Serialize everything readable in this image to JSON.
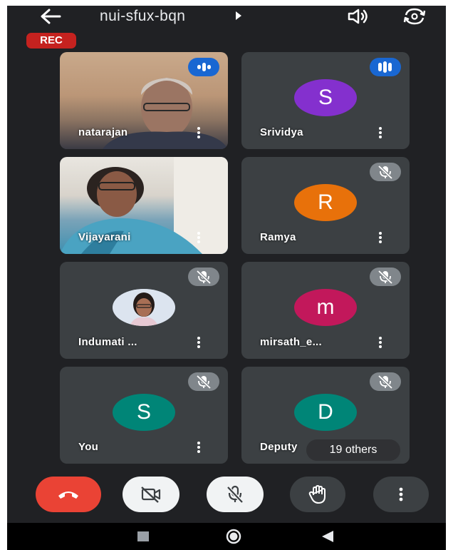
{
  "header": {
    "meeting_code": "nui-sfux-bqn",
    "rec_badge": "REC"
  },
  "participants": [
    {
      "name": "natarajan",
      "status": "speaking",
      "video": true
    },
    {
      "name": "Srividya",
      "initial": "S",
      "avatar_color": "#8430ce",
      "status": "speaking",
      "video": false
    },
    {
      "name": "Vijayarani",
      "status": "unmuted",
      "video": true
    },
    {
      "name": "Ramya",
      "initial": "R",
      "avatar_color": "#e8710a",
      "status": "muted",
      "video": false
    },
    {
      "name": "Indumati ...",
      "status": "muted",
      "video": false,
      "profile_photo": true
    },
    {
      "name": "mirsath_e...",
      "initial": "m",
      "avatar_color": "#c2185b",
      "status": "muted",
      "video": false
    },
    {
      "name": "You",
      "initial": "S",
      "avatar_color": "#008577",
      "status": "muted",
      "video": false
    },
    {
      "name": "Deputy",
      "initial": "D",
      "avatar_color": "#008577",
      "status": "muted",
      "video": false
    }
  ],
  "others_label": "19 others",
  "controls": {
    "end_call": "end-call",
    "camera": "camera-off",
    "microphone": "mic-off",
    "raise_hand": "raise-hand",
    "more": "more-options"
  },
  "colors": {
    "background": "#202124",
    "tile": "#3c4043",
    "end_call": "#ea4335",
    "rec": "#c5221f",
    "speaking": "#1967d2"
  }
}
